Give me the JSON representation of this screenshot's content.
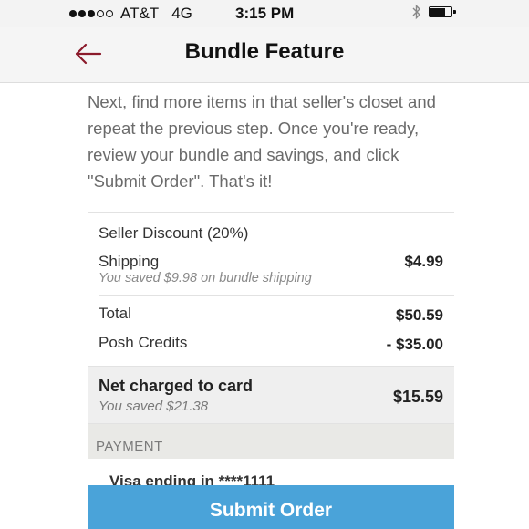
{
  "status_bar": {
    "carrier": "AT&T",
    "network": "4G",
    "time": "3:15 PM",
    "signal_bars_filled": 3,
    "signal_bars_total": 5,
    "battery_level": 0.8
  },
  "nav": {
    "title": "Bundle Feature",
    "back_icon": "arrow-left-icon",
    "accent_color": "#8b1a2b"
  },
  "intro_text": "Next, find more items in that seller's closet and repeat the previous step. Once you're ready, review your bundle and savings, and click \"Submit Order\". That's it!",
  "summary": {
    "seller_discount_label": "Seller Discount (20%)",
    "shipping_label": "Shipping",
    "shipping_note": "You saved $9.98 on bundle shipping",
    "shipping_amount": "$4.99",
    "total_label": "Total",
    "total_amount": "$50.59",
    "credits_label": "Posh Credits",
    "credits_amount": "- $35.00"
  },
  "net": {
    "label": "Net charged to card",
    "note": "You saved $21.38",
    "amount": "$15.59"
  },
  "payment": {
    "header": "PAYMENT",
    "card": "Visa ending in ****1111"
  },
  "submit_label": "Submit Order",
  "colors": {
    "button": "#4aa3d9",
    "accent": "#8b1a2b"
  }
}
